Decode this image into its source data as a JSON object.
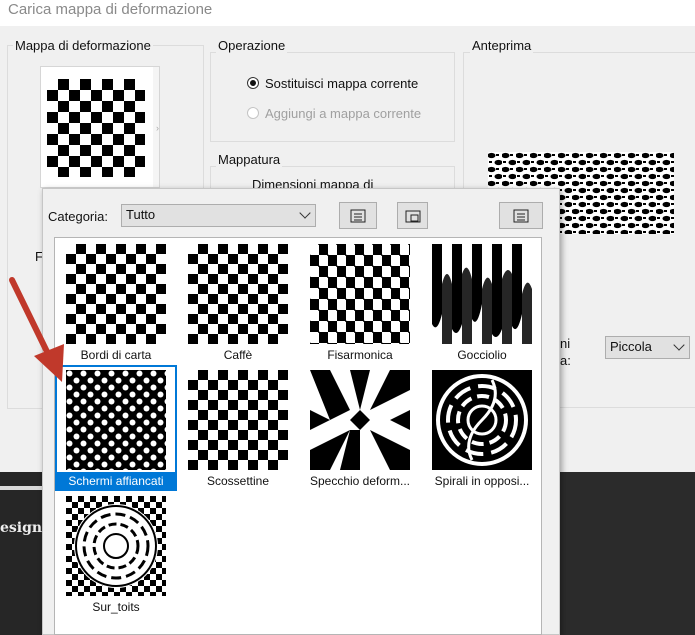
{
  "window": {
    "title": "Carica mappa di deformazione"
  },
  "left_panel": {
    "label": "Mappa di deformazione",
    "partial_label": "F"
  },
  "operation": {
    "label": "Operazione",
    "options": [
      {
        "label": "Sostituisci mappa corrente",
        "selected": true,
        "enabled": true
      },
      {
        "label": "Aggiungi a mappa corrente",
        "selected": false,
        "enabled": false
      }
    ]
  },
  "mapping": {
    "label": "Mappatura",
    "size_label": "Dimensioni mappa di"
  },
  "preview": {
    "label": "Anteprima",
    "partial_label_1": "ni",
    "partial_label_2": "a:",
    "size_value": "Piccola"
  },
  "background": {
    "partial_text": "esign"
  },
  "popup": {
    "category_label": "Categoria:",
    "category_value": "Tutto",
    "items": [
      {
        "label": "Bordi di carta",
        "pattern": "checker"
      },
      {
        "label": "Caffè",
        "pattern": "checker"
      },
      {
        "label": "Fisarmonica",
        "pattern": "checker-stretch"
      },
      {
        "label": "Gocciolio",
        "pattern": "drip"
      },
      {
        "label": "Schermi affiancati",
        "pattern": "tiled-screens",
        "selected": true
      },
      {
        "label": "Scossettine",
        "pattern": "checker"
      },
      {
        "label": "Specchio deform...",
        "pattern": "mirror"
      },
      {
        "label": "Spirali in opposi...",
        "pattern": "spiral"
      },
      {
        "label": "Sur_toits",
        "pattern": "roofs"
      }
    ]
  },
  "colors": {
    "accent": "#0078d7",
    "arrow": "#c0392b"
  }
}
